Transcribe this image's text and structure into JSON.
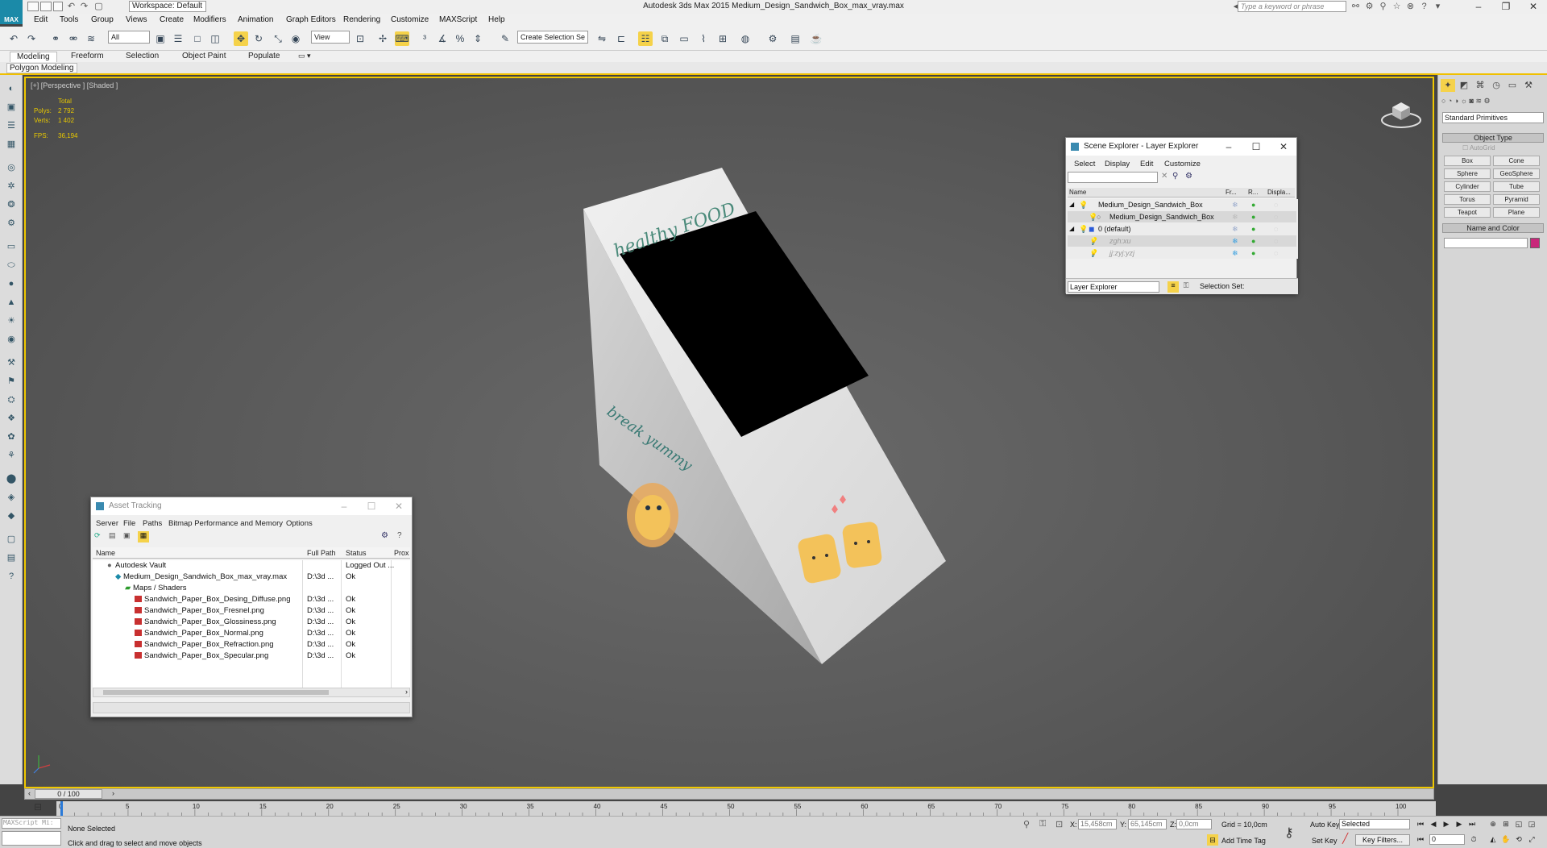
{
  "app": {
    "logo": "MAX",
    "title": "Autodesk 3ds Max  2015    Medium_Design_Sandwich_Box_max_vray.max",
    "workspace": "Workspace: Default",
    "search_placeholder": "Type a keyword or phrase"
  },
  "menu": [
    "Edit",
    "Tools",
    "Group",
    "Views",
    "Create",
    "Modifiers",
    "Animation",
    "Graph Editors",
    "Rendering",
    "Customize",
    "MAXScript",
    "Help"
  ],
  "toolbar": {
    "filter": "All",
    "ref_coord": "View",
    "selection_set": "Create Selection Se"
  },
  "ribbon": {
    "tabs": [
      "Modeling",
      "Freeform",
      "Selection",
      "Object Paint",
      "Populate"
    ],
    "sub_label": "Polygon Modeling"
  },
  "viewport": {
    "label": "[+] [Perspective ] [Shaded ]",
    "stats": {
      "total_label": "Total",
      "polys_label": "Polys:",
      "polys": "2 792",
      "verts_label": "Verts:",
      "verts": "1 402",
      "fps_label": "FPS:",
      "fps": "36,194"
    },
    "box_text": {
      "top": "healthy FOOD",
      "side": "break yummy"
    }
  },
  "scene_explorer": {
    "title": "Scene Explorer - Layer Explorer",
    "menu": [
      "Select",
      "Display",
      "Edit",
      "Customize"
    ],
    "columns": [
      "Name",
      "Fr...",
      "R...",
      "Displa..."
    ],
    "rows": [
      {
        "name": "Medium_Design_Sandwich_Box",
        "indent": 0
      },
      {
        "name": "Medium_Design_Sandwich_Box",
        "indent": 1
      },
      {
        "name": "0 (default)",
        "indent": 0
      },
      {
        "name": "zgh:xu",
        "indent": 1
      },
      {
        "name": "jj:zyj:yzj",
        "indent": 1
      }
    ],
    "footer_mode": "Layer Explorer",
    "footer_selection": "Selection Set:"
  },
  "asset_tracking": {
    "title": "Asset Tracking",
    "menu": [
      "Server",
      "File",
      "Paths",
      "Bitmap Performance and Memory",
      "Options"
    ],
    "columns": [
      "Name",
      "Full Path",
      "Status",
      "Prox"
    ],
    "rows": [
      {
        "name": "Autodesk Vault",
        "path": "",
        "status": "Logged Out ..."
      },
      {
        "name": "Medium_Design_Sandwich_Box_max_vray.max",
        "path": "D:\\3d ...",
        "status": "Ok"
      },
      {
        "name": "Maps / Shaders",
        "path": "",
        "status": ""
      },
      {
        "name": "Sandwich_Paper_Box_Desing_Diffuse.png",
        "path": "D:\\3d ...",
        "status": "Ok"
      },
      {
        "name": "Sandwich_Paper_Box_Fresnel.png",
        "path": "D:\\3d ...",
        "status": "Ok"
      },
      {
        "name": "Sandwich_Paper_Box_Glossiness.png",
        "path": "D:\\3d ...",
        "status": "Ok"
      },
      {
        "name": "Sandwich_Paper_Box_Normal.png",
        "path": "D:\\3d ...",
        "status": "Ok"
      },
      {
        "name": "Sandwich_Paper_Box_Refraction.png",
        "path": "D:\\3d ...",
        "status": "Ok"
      },
      {
        "name": "Sandwich_Paper_Box_Specular.png",
        "path": "D:\\3d ...",
        "status": "Ok"
      }
    ]
  },
  "command_panel": {
    "dropdown": "Standard Primitives",
    "object_type_header": "Object Type",
    "autogrid": "AutoGrid",
    "buttons": [
      "Box",
      "Cone",
      "Sphere",
      "GeoSphere",
      "Cylinder",
      "Tube",
      "Torus",
      "Pyramid",
      "Teapot",
      "Plane"
    ],
    "name_color_header": "Name and Color",
    "swatch_color": "#c8287a"
  },
  "timeline": {
    "frame": "0 / 100",
    "ticks": [
      "0",
      "5",
      "10",
      "15",
      "20",
      "25",
      "30",
      "35",
      "40",
      "45",
      "50",
      "55",
      "60",
      "65",
      "70",
      "75",
      "80",
      "85",
      "90",
      "95",
      "100"
    ]
  },
  "status": {
    "maxscript": "MAXScript Mi:",
    "selection": "None Selected",
    "prompt": "Click and drag to select and move objects",
    "x_label": "X:",
    "x": "15,458cm",
    "y_label": "Y:",
    "y": "65,145cm",
    "z_label": "Z:",
    "z": "0,0cm",
    "grid": "Grid = 10,0cm",
    "add_time_tag": "Add Time Tag",
    "auto_key": "Auto Key",
    "set_key": "Set Key",
    "key_mode": "Selected",
    "key_filters": "Key Filters...",
    "current_frame": "0"
  }
}
